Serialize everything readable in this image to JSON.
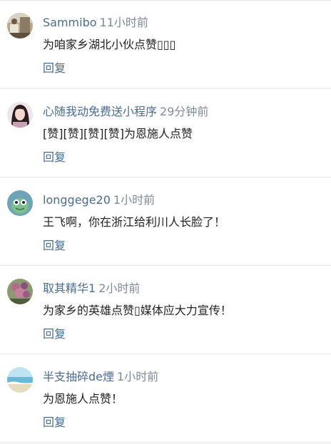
{
  "comments": [
    {
      "username": "Sammibo",
      "time": "11小时前",
      "text": "为咱家乡湖北小伙点赞▯▯▯",
      "reply_label": "回复",
      "avatar_icon": "photo-avatar-icon"
    },
    {
      "username": "心随我动免费送小程序",
      "time": "29分钟前",
      "text": "[赞][赞][赞][赞]为恩施人点赞",
      "reply_label": "回复",
      "avatar_icon": "woman-avatar-icon"
    },
    {
      "username": "longgege20",
      "time": "1小时前",
      "text": "王飞啊，你在浙江给利川人长脸了！",
      "reply_label": "回复",
      "avatar_icon": "cartoon-avatar-icon"
    },
    {
      "username": "取其精华1",
      "time": "2小时前",
      "text": "为家乡的英雄点赞▯媒体应大力宣传！",
      "reply_label": "回复",
      "avatar_icon": "flower-avatar-icon"
    },
    {
      "username": "半支抽碎de煙",
      "time": "1小时前",
      "text": "为恩施人点赞！",
      "reply_label": "回复",
      "avatar_icon": "beach-avatar-icon"
    }
  ],
  "colors": {
    "username": "#4a6c93",
    "time": "#7d8a99",
    "text": "#222222",
    "reply": "#4a6c93",
    "divider": "#e8e8e8"
  }
}
